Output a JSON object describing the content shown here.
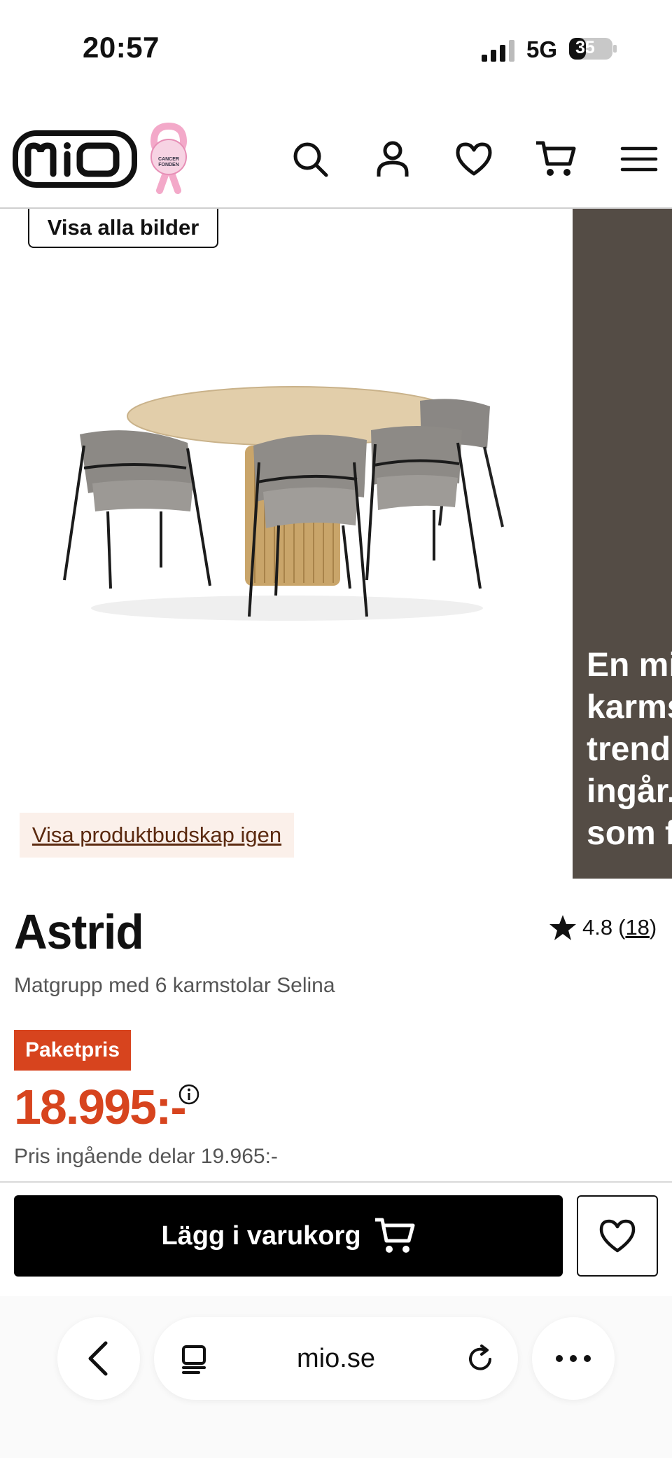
{
  "status_bar": {
    "time": "20:57",
    "network": "5G",
    "battery": "35"
  },
  "header": {
    "logo_text": "mio",
    "ribbon_text": "CANCER FONDEN",
    "icons": [
      "search-icon",
      "account-icon",
      "heart-icon",
      "cart-icon",
      "menu-icon"
    ]
  },
  "gallery": {
    "show_all_images_label": "Visa alla bilder",
    "show_message_label": "Visa produktbudskap igen",
    "side_panel_text": "En mix\nkarms\ntrendi\ningår.\nsom f"
  },
  "product": {
    "title": "Astrid",
    "subtitle": "Matgrupp med 6 karmstolar Selina",
    "rating": "4.8",
    "rating_count": "18",
    "badge": "Paketpris",
    "price": "18.995:-",
    "parts_price": "Pris ingående delar 19.965:-"
  },
  "actions": {
    "add_to_cart_label": "Lägg i varukorg"
  },
  "browser": {
    "url": "mio.se"
  },
  "colors": {
    "accent": "#d7441e",
    "panel": "#544c45",
    "ribbon": "#f3a9c9"
  }
}
